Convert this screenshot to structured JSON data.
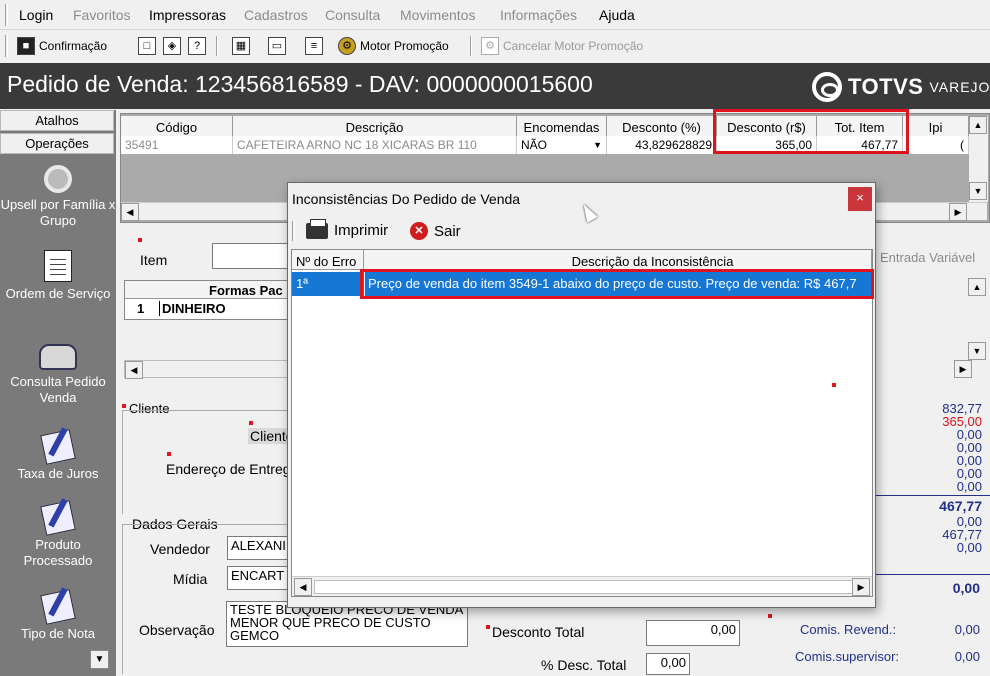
{
  "menu": {
    "login": "Login",
    "favoritos": "Favoritos",
    "impressoras": "Impressoras",
    "cadastros": "Cadastros",
    "consulta": "Consulta",
    "movimentos": "Movimentos",
    "informacoes": "Informações",
    "ajuda": "Ajuda"
  },
  "toolbar": {
    "confirmacao": "Confirmação",
    "motor_promocao": "Motor Promoção",
    "cancelar_motor": "Cancelar Motor Promoção"
  },
  "header": {
    "title": "Pedido de Venda: 123456816589  - DAV: 0000000015600",
    "brand_name": "TOTVS",
    "brand_sub": "VAREJO"
  },
  "sidebar": {
    "tab_atalhos": "Atalhos",
    "tab_operacoes": "Operações",
    "items": [
      {
        "label": "Upsell por Família  x Grupo",
        "icon": "magnifier-icon"
      },
      {
        "label": "Ordem de Serviço",
        "icon": "document-icon"
      },
      {
        "label": "Consulta Pedido Venda",
        "icon": "handshake-icon"
      },
      {
        "label": "Taxa de Juros",
        "icon": "note-pen-icon"
      },
      {
        "label": "Produto Processado",
        "icon": "note-pen-icon"
      },
      {
        "label": "Tipo de Nota",
        "icon": "note-pen-icon"
      }
    ]
  },
  "grid": {
    "headers": [
      "Código",
      "Descrição",
      "Encomendas",
      "Desconto (%)",
      "Desconto (r$)",
      "Tot. Item",
      "Ipi"
    ],
    "row": {
      "codigo": "35491",
      "descricao": "CAFETEIRA ARNO NC 18 XICARAS  BR 110",
      "encomendas": "NÃO",
      "desconto_pct": "43,829628829",
      "desconto_rs": "365,00",
      "tot_item": "467,77",
      "ipi": "("
    }
  },
  "middle": {
    "item_label": "Item",
    "formas_header": "Formas Pac",
    "pagamento_idx": "1",
    "pagamento_name": "DINHEIRO",
    "entrada_variavel": "Entrada Variável"
  },
  "cliente": {
    "group_label": "Cliente",
    "cliente_label": "Cliente",
    "endereco_label": "Endereço de Entreg"
  },
  "dados_gerais": {
    "group_label": "Dados Gerais",
    "vendedor_label": "Vendedor",
    "vendedor_value": "ALEXANI",
    "midia_label": "Mídia",
    "midia_value": "ENCART",
    "observacao_label": "Observação",
    "observacao_value": "TESTE BLOQUEIO PRECO DE VENDA MENOR QUE PRECO DE CUSTO GEMCO",
    "desconto_total_label": "Desconto Total",
    "desconto_total_value": "0,00",
    "pct_desc_total_label": "% Desc. Total",
    "pct_desc_total_value": "0,00"
  },
  "totals": {
    "v1": "832,77",
    "v2": "365,00",
    "v3": "0,00",
    "v4": "0,00",
    "v5": "0,00",
    "v6": "0,00",
    "v7": "0,00",
    "bold1": "467,77",
    "v8": "0,00",
    "v9": "467,77",
    "v10": "0,00",
    "bold2": "0,00",
    "comis_revend_label": "Comis. Revend.:",
    "comis_revend_value": "0,00",
    "comis_super_label": "Comis.supervisor:",
    "comis_super_value": "0,00"
  },
  "dialog": {
    "title": "Inconsistências Do Pedido de Venda",
    "close": "×",
    "imprimir": "Imprimir",
    "sair": "Sair",
    "col_erro": "Nº do Erro",
    "col_descricao": "Descrição da Inconsistência",
    "row_erro": "1ª",
    "row_descricao": "Preço de venda do item 3549-1 abaixo do preço de custo. Preço de venda: R$ 467,7"
  },
  "colors": {
    "accent_red": "#e0141e",
    "selection_blue": "#1677d4",
    "title_bg": "#3a3a3a"
  }
}
